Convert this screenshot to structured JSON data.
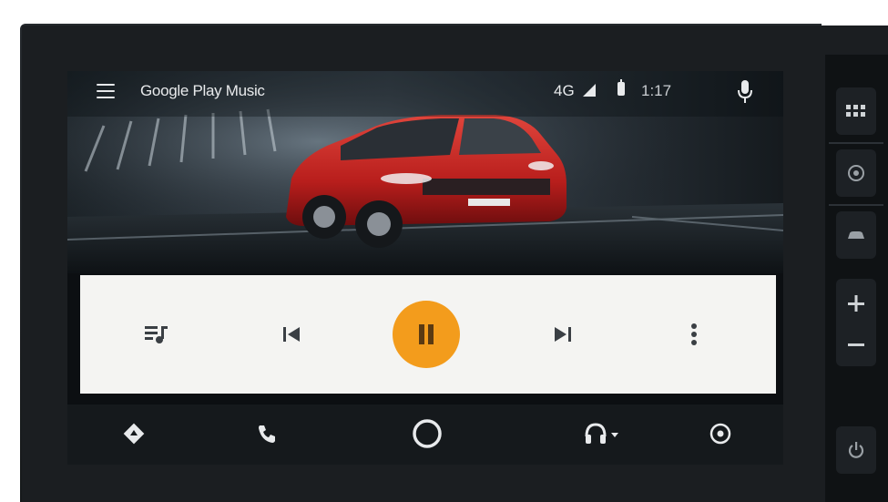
{
  "status_bar": {
    "app_title": "Google Play Music",
    "network": "4G",
    "time": "1:17"
  },
  "icons": {
    "menu": "hamburger-menu-icon",
    "signal": "cell-signal-icon",
    "battery": "battery-icon",
    "mic": "microphone-icon",
    "queue": "queue-music-icon",
    "previous": "skip-previous-icon",
    "pause": "pause-icon",
    "next": "skip-next-icon",
    "more": "more-vert-icon",
    "navigation": "navigation-icon",
    "phone": "phone-icon",
    "home": "home-circle-icon",
    "audio": "headphones-icon",
    "recents": "recents-icon"
  },
  "colors": {
    "accent": "#f39c1c",
    "controls_bg": "#f4f4f2",
    "navbar_bg": "#15191c"
  }
}
